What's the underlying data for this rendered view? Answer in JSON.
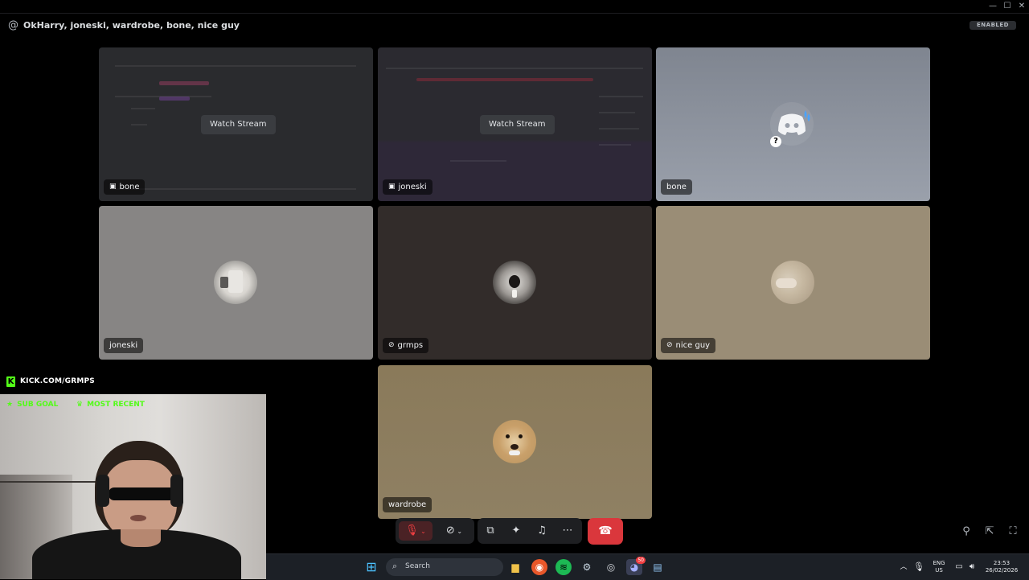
{
  "window": {
    "title": "OkHarry, joneski, wardrobe, bone, nice guy",
    "badge": "ENABLED",
    "controls": {
      "minimize": "—",
      "maximize": "☐",
      "close": "✕"
    }
  },
  "tiles": [
    {
      "name": "bone",
      "type": "stream",
      "action": "Watch Stream",
      "bg": "#2a2b2e"
    },
    {
      "name": "joneski",
      "type": "stream",
      "action": "Watch Stream",
      "bg": "#2b2a30"
    },
    {
      "name": "bone",
      "type": "avatar",
      "bg": "#8f95a1",
      "avatar_icon": "discord-logo-icon"
    },
    {
      "name": "joneski",
      "type": "avatar",
      "bg": "#878584"
    },
    {
      "name": "grmps",
      "type": "avatar",
      "muted": true,
      "bg": "#322c2a"
    },
    {
      "name": "nice guy",
      "type": "avatar",
      "muted": true,
      "bg": "#9a8d76"
    },
    {
      "name": "wardrobe",
      "type": "avatar",
      "bg": "#8d7d5c"
    }
  ],
  "controls": {
    "mic": "mic-muted-icon",
    "camera": "camera-off-icon",
    "share_screen": "screen-share-icon",
    "activities": "activities-icon",
    "soundboard": "soundboard-icon",
    "more": "more-icon",
    "end_call": "end-call-icon",
    "end_call_color": "#da373c"
  },
  "overlay": {
    "kick_label": "KICK.COM/GRMPS",
    "sub_goal": "SUB GOAL",
    "most_recent": "MOST RECENT",
    "accent": "#53fc18"
  },
  "taskbar": {
    "search_placeholder": "Search",
    "lang_top": "ENG",
    "lang_bottom": "US",
    "time": "23:53",
    "date": "26/02/2026",
    "discord_badge": "50"
  }
}
